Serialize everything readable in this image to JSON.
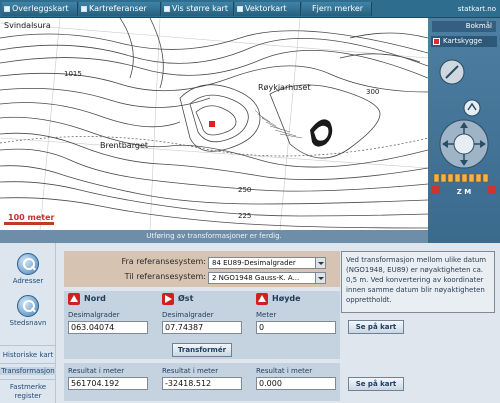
{
  "topbar": {
    "tabs": [
      "Overleggskart",
      "Kartreferanser",
      "Vis større kart",
      "Vektorkart",
      "Fjern merker"
    ],
    "logo": "statkart.no"
  },
  "map": {
    "labels": {
      "place1": "Svindalsura",
      "place2": "Røykjarhuset",
      "place3": "Brentbarget",
      "spot1": "1015",
      "spot2": "300",
      "spot3": "250",
      "spot4": "225"
    },
    "scale_label": "100 meter",
    "status": "Utføring av transformasjoner er ferdig."
  },
  "rightpanel": {
    "language": "Bokmål",
    "shade_button": "Kartskygge",
    "zoom_label": "Z M"
  },
  "left": {
    "addresses": "Adresser",
    "placenames": "Stedsnavn",
    "historical": "Historiske kart",
    "transform": "Transformasjon",
    "fixed_points": "Fastmerke register"
  },
  "form": {
    "from_label": "Fra referansesystem:",
    "from_value": "84 EU89-Desimalgrader",
    "to_label": "Til referansesystem:",
    "to_value": "2 NGO1948 Gauss-K. A...",
    "north": {
      "heading": "Nord",
      "field_label": "Desimalgrader",
      "value": "063.04074"
    },
    "east": {
      "heading": "Øst",
      "field_label": "Desimalgrader",
      "value": "07.74387"
    },
    "height": {
      "heading": "Høyde",
      "field_label": "Meter",
      "value": "0"
    },
    "transform_button": "Transformér",
    "results": [
      {
        "label": "Resultat i meter",
        "value": "561704.192"
      },
      {
        "label": "Resultat i meter",
        "value": "-32418.512"
      },
      {
        "label": "Resultat i meter",
        "value": "0.000"
      }
    ]
  },
  "info": {
    "text": "Ved transformasjon mellom ulike datum (NGO1948, EU89) er nøyaktigheten ca. 0,5 m. Ved konvertering av koordinater innen samme datum blir nøyaktigheten opprettholdt.",
    "view_map_1": "Se på kart",
    "view_map_2": "Se på kart"
  },
  "colors": {
    "topbar": "#2f6d8f",
    "panel": "#c5d3e0",
    "refbox": "#d7c3b1",
    "marker": "#e02020"
  }
}
